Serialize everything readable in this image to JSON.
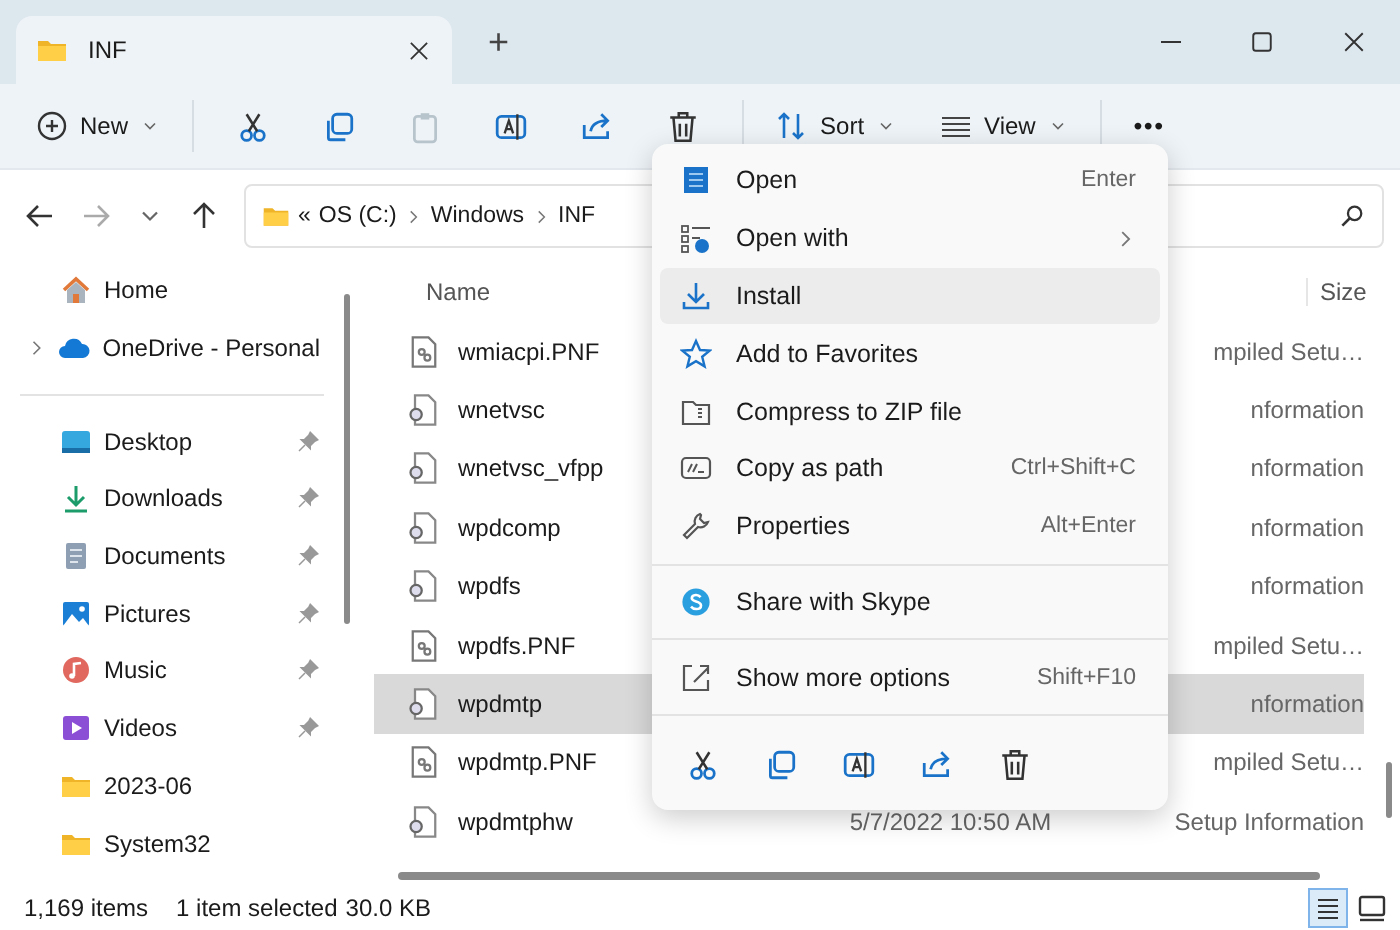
{
  "tab": {
    "title": "INF",
    "new_tab": "+"
  },
  "toolbar": {
    "new": "New",
    "sort": "Sort",
    "view": "View",
    "more": "•••",
    "actions": [
      {
        "kind": "cut",
        "disabled": false
      },
      {
        "kind": "copy",
        "disabled": false
      },
      {
        "kind": "paste",
        "disabled": true
      },
      {
        "kind": "rename",
        "disabled": false
      },
      {
        "kind": "share",
        "disabled": false
      },
      {
        "kind": "delete",
        "disabled": false
      }
    ]
  },
  "address": {
    "prefix": "«",
    "segments": [
      "OS (C:)",
      "Windows",
      "INF"
    ]
  },
  "sidebar": {
    "sections": [
      [
        {
          "label": "Home",
          "kind": "home",
          "expandable": false,
          "pinned": false
        },
        {
          "label": "OneDrive - Personal",
          "kind": "cloud",
          "expandable": true,
          "pinned": false
        }
      ],
      [
        {
          "label": "Desktop",
          "kind": "desktop",
          "expandable": false,
          "pinned": true
        },
        {
          "label": "Downloads",
          "kind": "download",
          "expandable": false,
          "pinned": true
        },
        {
          "label": "Documents",
          "kind": "documents",
          "expandable": false,
          "pinned": true
        },
        {
          "label": "Pictures",
          "kind": "pictures",
          "expandable": false,
          "pinned": true
        },
        {
          "label": "Music",
          "kind": "music",
          "expandable": false,
          "pinned": true
        },
        {
          "label": "Videos",
          "kind": "videos",
          "expandable": false,
          "pinned": true
        },
        {
          "label": "2023-06",
          "kind": "folder",
          "expandable": false,
          "pinned": false
        },
        {
          "label": "System32",
          "kind": "folder",
          "expandable": false,
          "pinned": false
        }
      ]
    ]
  },
  "file_list": {
    "columns": [
      "Name",
      "Size"
    ],
    "rows": [
      {
        "name": "wmiacpi.PNF",
        "kind": "pnf",
        "type": "mpiled Setu…",
        "selected": false
      },
      {
        "name": "wnetvsc",
        "kind": "inf",
        "type": "nformation",
        "selected": false
      },
      {
        "name": "wnetvsc_vfpp",
        "kind": "inf",
        "type": "nformation",
        "selected": false
      },
      {
        "name": "wpdcomp",
        "kind": "inf",
        "type": "nformation",
        "selected": false
      },
      {
        "name": "wpdfs",
        "kind": "inf",
        "type": "nformation",
        "selected": false
      },
      {
        "name": "wpdfs.PNF",
        "kind": "pnf",
        "type": "mpiled Setu…",
        "selected": false
      },
      {
        "name": "wpdmtp",
        "kind": "inf",
        "type": "nformation",
        "selected": true
      },
      {
        "name": "wpdmtp.PNF",
        "kind": "pnf",
        "type": "mpiled Setu…",
        "selected": false
      },
      {
        "name": "wpdmtphw",
        "kind": "inf",
        "date": "5/7/2022 10:50 AM",
        "type": "Setup Information",
        "selected": false
      }
    ]
  },
  "context_menu": {
    "sections": [
      [
        {
          "kind": "open",
          "label": "Open",
          "shortcut": "Enter",
          "submenu": false,
          "selected": false
        },
        {
          "kind": "openwith",
          "label": "Open with",
          "submenu": true,
          "selected": false
        },
        {
          "kind": "install",
          "label": "Install",
          "submenu": false,
          "selected": true
        },
        {
          "kind": "star",
          "label": "Add to Favorites",
          "submenu": false,
          "selected": false
        },
        {
          "kind": "zip",
          "label": "Compress to ZIP file",
          "submenu": false,
          "selected": false
        },
        {
          "kind": "path",
          "label": "Copy as path",
          "shortcut": "Ctrl+Shift+C",
          "submenu": false,
          "selected": false
        },
        {
          "kind": "wrench",
          "label": "Properties",
          "shortcut": "Alt+Enter",
          "submenu": false,
          "selected": false
        }
      ],
      [
        {
          "kind": "skype",
          "label": "Share with Skype",
          "submenu": false,
          "selected": false
        }
      ],
      [
        {
          "kind": "more",
          "label": "Show more options",
          "shortcut": "Shift+F10",
          "submenu": false,
          "selected": false
        }
      ]
    ],
    "actions": [
      {
        "kind": "cut"
      },
      {
        "kind": "copy"
      },
      {
        "kind": "rename"
      },
      {
        "kind": "share"
      },
      {
        "kind": "delete"
      }
    ]
  },
  "status_bar": {
    "count": "1,169 items",
    "selection": "1 item selected",
    "size": "30.0 KB",
    "views": [
      {
        "kind": "details",
        "selected": true
      },
      {
        "kind": "tiles",
        "selected": false
      }
    ]
  }
}
